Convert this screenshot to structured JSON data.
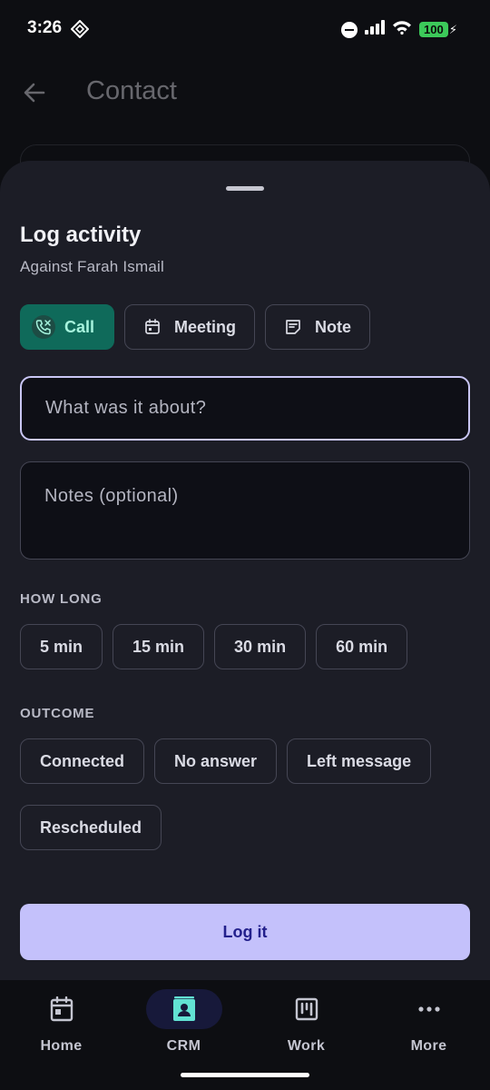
{
  "status_bar": {
    "time": "3:26",
    "battery": "100",
    "icons": [
      "app-diamond-icon",
      "do-not-disturb-icon",
      "signal-icon",
      "wifi-icon",
      "battery-icon"
    ]
  },
  "background_page": {
    "title": "Contact"
  },
  "sheet": {
    "title": "Log activity",
    "subtitle": "Against Farah Ismail",
    "activity_types": [
      {
        "label": "Call",
        "icon": "phone-call-icon",
        "selected": true
      },
      {
        "label": "Meeting",
        "icon": "calendar-icon",
        "selected": false
      },
      {
        "label": "Note",
        "icon": "note-icon",
        "selected": false
      }
    ],
    "subject_input": {
      "value": "",
      "placeholder": "What was it about?"
    },
    "notes_input": {
      "value": "",
      "placeholder": "Notes (optional)"
    },
    "how_long_label": "HOW LONG",
    "durations": [
      "5 min",
      "15 min",
      "30 min",
      "60 min"
    ],
    "outcome_label": "OUTCOME",
    "outcomes": [
      "Connected",
      "No answer",
      "Left message",
      "Rescheduled"
    ],
    "submit_label": "Log it"
  },
  "bottom_nav": {
    "items": [
      {
        "label": "Home",
        "icon": "calendar-home-icon",
        "active": false
      },
      {
        "label": "CRM",
        "icon": "contact-card-icon",
        "active": true
      },
      {
        "label": "Work",
        "icon": "kanban-board-icon",
        "active": false
      },
      {
        "label": "More",
        "icon": "more-dots-icon",
        "active": false
      }
    ]
  },
  "colors": {
    "sheet_bg": "#1c1d26",
    "accent_selected": "#0f6a5a",
    "primary_button": "#c4c1fb",
    "focus_border": "#c9c6f5"
  }
}
